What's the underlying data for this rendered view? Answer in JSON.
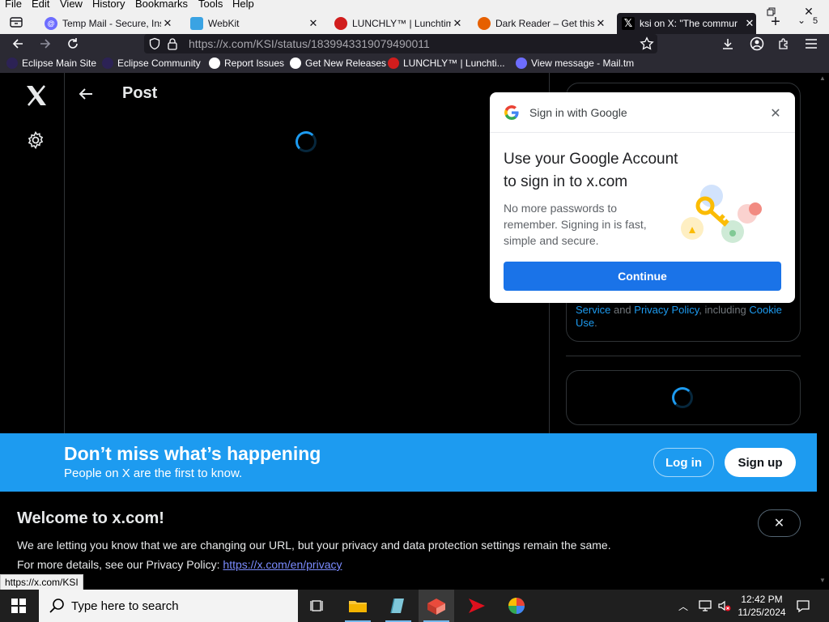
{
  "menubar": {
    "items": [
      "File",
      "Edit",
      "View",
      "History",
      "Bookmarks",
      "Tools",
      "Help"
    ]
  },
  "tabs": [
    {
      "title": "Temp Mail - Secure, Ins",
      "color": "#6d6dff"
    },
    {
      "title": "WebKit",
      "color": "#3aa3e3"
    },
    {
      "title": "LUNCHLY™ | Lunchtim",
      "color": "#d11d1d"
    },
    {
      "title": "Dark Reader – Get this I",
      "color": "#e66000"
    },
    {
      "title": "ksi on X: \"The commur",
      "color": "#000000"
    }
  ],
  "tabstrip": {
    "overflow_count": "5"
  },
  "url": {
    "full": "https://x.com/KSI/status/1839943319079490011"
  },
  "bookmarks": [
    {
      "label": "Eclipse Main Site",
      "color": "#2c2255"
    },
    {
      "label": "Eclipse Community",
      "color": "#2c2255"
    },
    {
      "label": "Report Issues",
      "color": "#ffffff"
    },
    {
      "label": "Get New Releases",
      "color": "#ffffff"
    },
    {
      "label": "LUNCHLY™ | Lunchti...",
      "color": "#d11d1d"
    },
    {
      "label": "View message - Mail.tm",
      "color": "#6d6dff"
    }
  ],
  "post": {
    "title": "Post"
  },
  "google_popup": {
    "header": "Sign in with Google",
    "heading_line1": "Use your Google Account",
    "heading_line2": "to sign in to x.com",
    "body_line1": "No more passwords to",
    "body_line2": "remember. Signing in is fast,",
    "body_line3": "simple and secure.",
    "continue_label": "Continue"
  },
  "sidebar_terms": {
    "service": "Service",
    "and": " and ",
    "privacy": "Privacy Policy",
    "including": ", including ",
    "cookie": "Cookie",
    "use": "Use",
    "period": "."
  },
  "banner": {
    "title": "Don’t miss what’s happening",
    "subtitle": "People on X are the first to know.",
    "login_label": "Log in",
    "signup_label": "Sign up"
  },
  "welcome": {
    "title": "Welcome to x.com!",
    "line1": "We are letting you know that we are changing our URL, but your privacy and data protection settings remain the same.",
    "line2_prefix": "For more details, see our Privacy Policy: ",
    "line2_link": "https://x.com/en/privacy"
  },
  "status_url": "https://x.com/KSI",
  "taskbar": {
    "search_placeholder": "Type here to search",
    "time": "12:42 PM",
    "date": "11/25/2024"
  },
  "colors": {
    "x_blue": "#1d9bf0",
    "google_blue": "#1a73e8",
    "firefox_dark": "#2b2a33"
  }
}
